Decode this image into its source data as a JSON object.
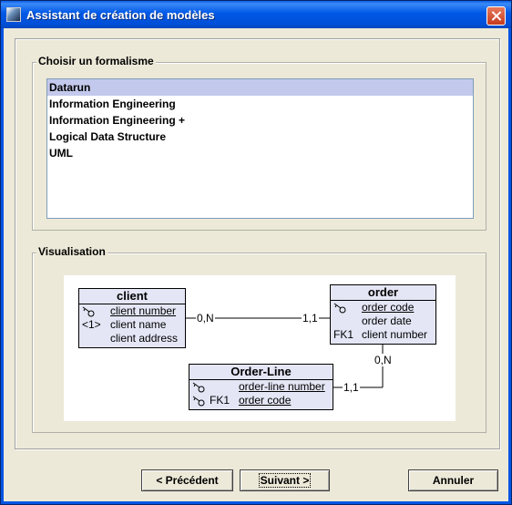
{
  "window": {
    "title": "Assistant de création de modèles"
  },
  "formalism_group": {
    "title": "Choisir un formalisme",
    "items": [
      {
        "label": "Datarun",
        "selected": true
      },
      {
        "label": "Information Engineering",
        "selected": false
      },
      {
        "label": "Information Engineering +",
        "selected": false
      },
      {
        "label": "Logical Data Structure",
        "selected": false
      },
      {
        "label": "UML",
        "selected": false
      }
    ]
  },
  "visualisation_group": {
    "title": "Visualisation",
    "diagram": {
      "entities": {
        "client": {
          "name": "client",
          "attributes": [
            "client number",
            "client name",
            "client address"
          ],
          "prefixes": [
            "",
            "<1>",
            ""
          ]
        },
        "order": {
          "name": "order",
          "attributes": [
            "order code",
            "order date",
            "client number"
          ],
          "prefixes": [
            "",
            "",
            "FK1"
          ]
        },
        "order_line": {
          "name": "Order-Line",
          "attributes": [
            "order-line number",
            "order code"
          ],
          "prefixes": [
            "",
            "FK1"
          ]
        }
      },
      "cardinalities": {
        "client_side": "0,N",
        "order_side_client": "1,1",
        "order_side_line": "0,N",
        "line_side": "1,1"
      }
    }
  },
  "buttons": {
    "previous": "< Précédent",
    "next": "Suivant >",
    "cancel": "Annuler"
  },
  "colors": {
    "title_bar": "#0054e3",
    "selection": "#c3c9ec",
    "entity_fill": "#e4e6f5",
    "dialog_bg": "#ece9d8"
  }
}
